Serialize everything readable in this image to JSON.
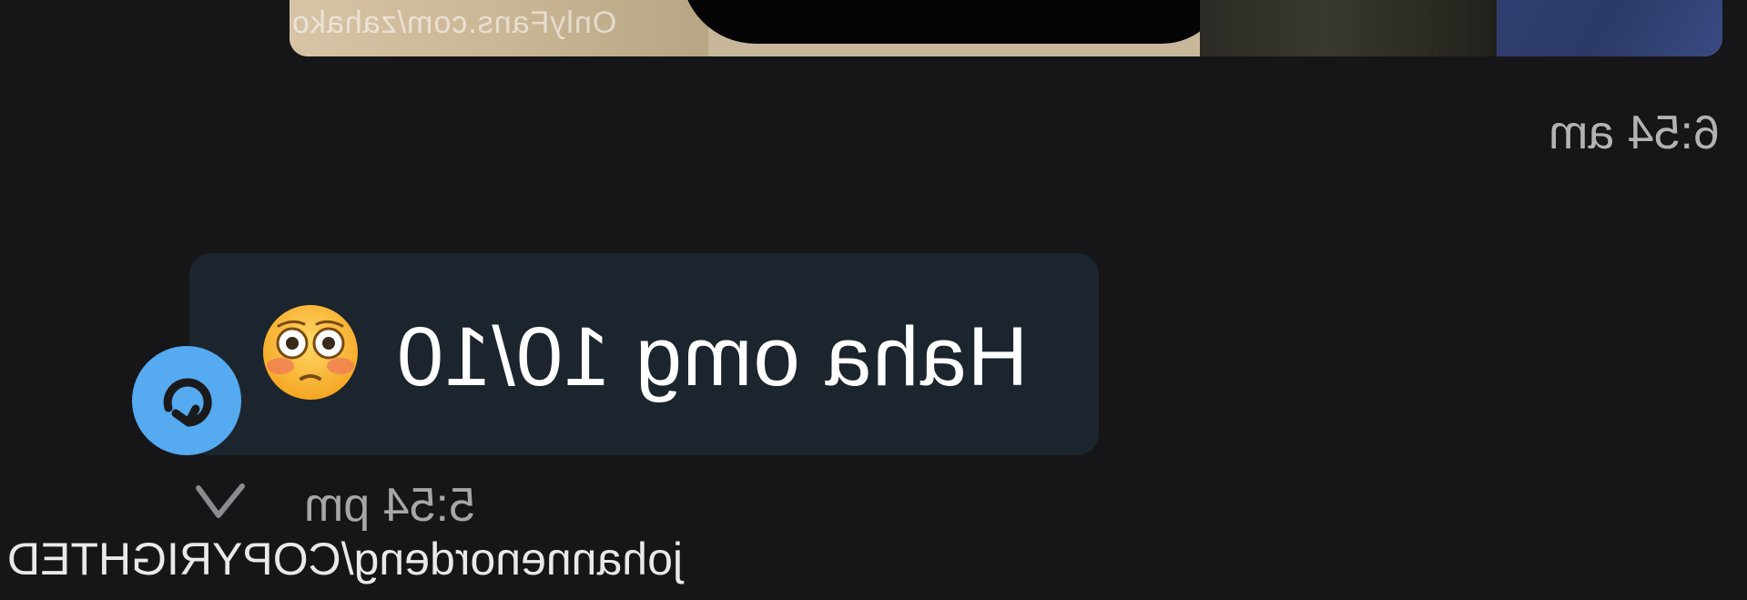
{
  "media": {
    "watermark": "OnlyFans.com/zahako"
  },
  "messages": [
    {
      "time": "6:54 am"
    },
    {
      "text": "Haha omg 10/10",
      "emoji": "flushed-face-emoji",
      "time": "5:54 pm"
    }
  ],
  "footer": {
    "watermark": "johannenordeng/COPYRIGHTED"
  },
  "colors": {
    "background": "#161618",
    "bubble": "#1c252d",
    "reply_accent": "#55aaf0",
    "timestamp": "#b3b3b6"
  }
}
